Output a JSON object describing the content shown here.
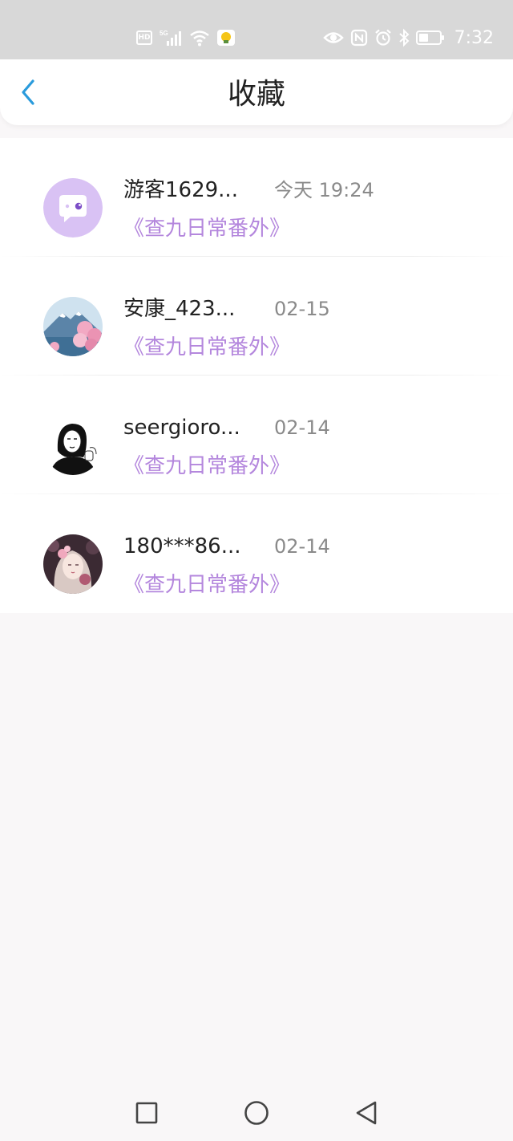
{
  "status_bar": {
    "hd_label": "HD",
    "network_label": "5G",
    "time": "7:32"
  },
  "header": {
    "title": "收藏"
  },
  "favorites": [
    {
      "user": "游客1629...",
      "time": "今天 19:24",
      "work": "《查九日常番外》"
    },
    {
      "user": "安康_423...",
      "time": "02-15",
      "work": "《查九日常番外》"
    },
    {
      "user": "seergioro...",
      "time": "02-14",
      "work": "《查九日常番外》"
    },
    {
      "user": "180***86...",
      "time": "02-14",
      "work": "《查九日常番外》"
    }
  ],
  "colors": {
    "accent": "#2a9bdc",
    "work_title": "#b487dd",
    "status_bar_bg": "#d8d8d8",
    "page_bg": "#f9f7f8"
  },
  "icons": {
    "back": "chevron-left-icon",
    "nav_recent": "square-icon",
    "nav_home": "circle-icon",
    "nav_back": "triangle-back-icon"
  }
}
